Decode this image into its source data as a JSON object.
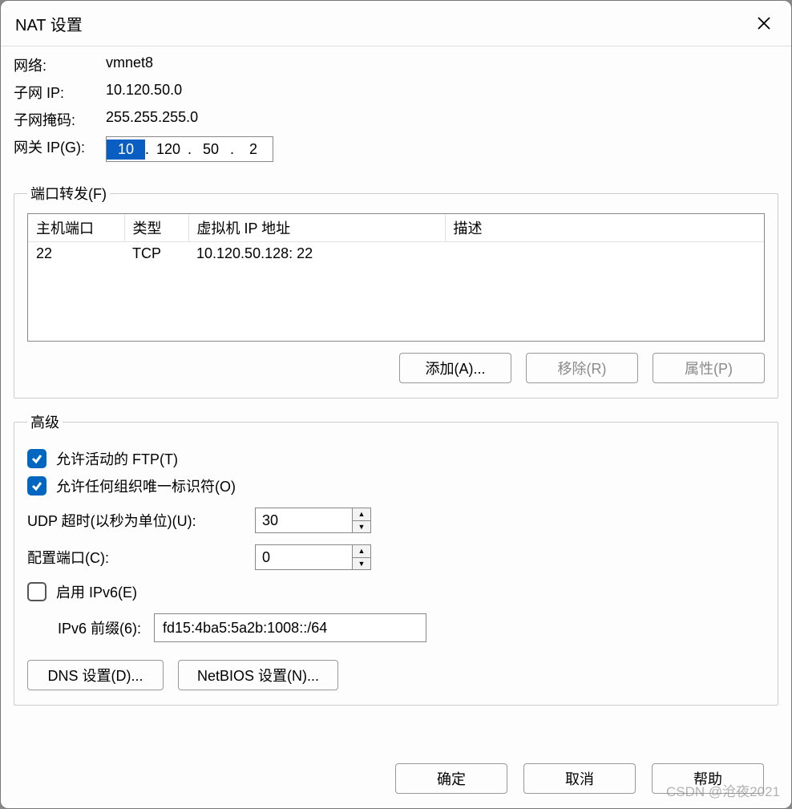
{
  "title": "NAT 设置",
  "info": {
    "network_label": "网络:",
    "network_value": "vmnet8",
    "subnet_ip_label": "子网 IP:",
    "subnet_ip_value": "10.120.50.0",
    "subnet_mask_label": "子网掩码:",
    "subnet_mask_value": "255.255.255.0",
    "gateway_label": "网关 IP(G):",
    "gateway_octets": [
      "10",
      "120",
      "50",
      "2"
    ]
  },
  "port_forwarding": {
    "legend": "端口转发(F)",
    "headers": {
      "host_port": "主机端口",
      "type": "类型",
      "vm_ip": "虚拟机 IP 地址",
      "desc": "描述"
    },
    "rows": [
      {
        "host_port": "22",
        "type": "TCP",
        "vm_ip": "10.120.50.128: 22",
        "desc": ""
      }
    ],
    "buttons": {
      "add": "添加(A)...",
      "remove": "移除(R)",
      "properties": "属性(P)"
    }
  },
  "advanced": {
    "legend": "高级",
    "allow_active_ftp": {
      "checked": true,
      "label": "允许活动的 FTP(T)"
    },
    "allow_oui": {
      "checked": true,
      "label": "允许任何组织唯一标识符(O)"
    },
    "udp_timeout": {
      "label": "UDP 超时(以秒为单位)(U):",
      "value": "30"
    },
    "config_port": {
      "label": "配置端口(C):",
      "value": "0"
    },
    "enable_ipv6": {
      "checked": false,
      "label": "启用 IPv6(E)"
    },
    "ipv6_prefix": {
      "label": "IPv6 前缀(6):",
      "value": "fd15:4ba5:5a2b:1008::/64"
    },
    "dns_btn": "DNS 设置(D)...",
    "netbios_btn": "NetBIOS 设置(N)..."
  },
  "footer": {
    "ok": "确定",
    "cancel": "取消",
    "help": "帮助"
  },
  "watermark": "CSDN @沧夜2021"
}
